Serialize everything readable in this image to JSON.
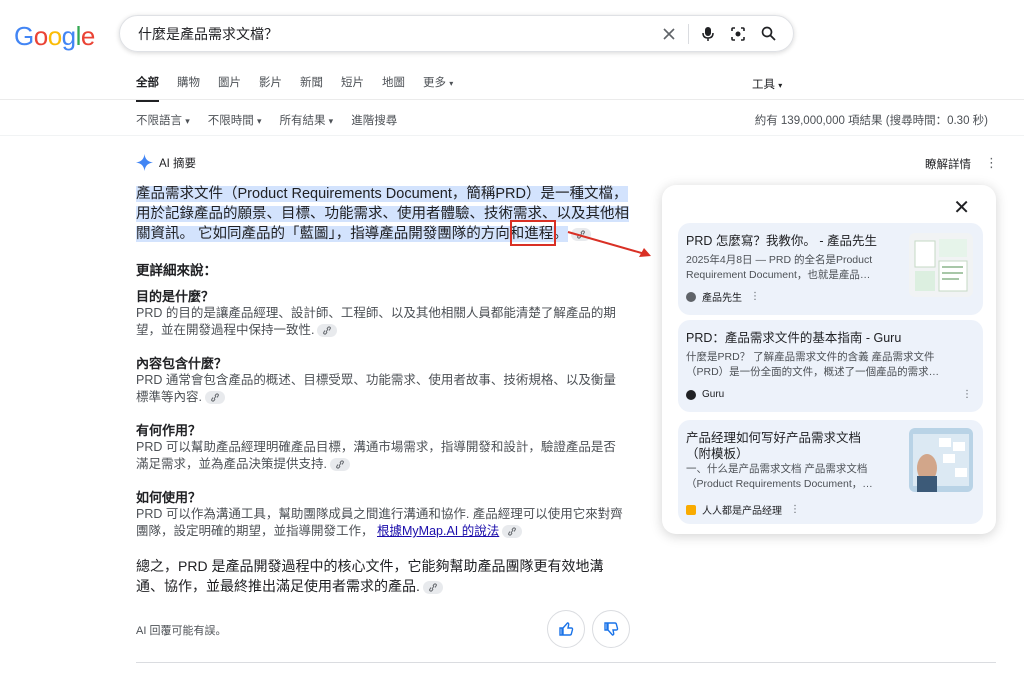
{
  "logo": "Google",
  "search": {
    "query": "什麼是產品需求文檔？"
  },
  "tabs": [
    "全部",
    "購物",
    "圖片",
    "影片",
    "新聞",
    "短片",
    "地圖",
    "更多"
  ],
  "tools_label": "工具",
  "filters": [
    "不限語言",
    "不限時間",
    "所有結果",
    "進階搜尋"
  ],
  "stats": "約有 139,000,000 項結果 (搜尋時間：0.30 秒)",
  "ai": {
    "header": "AI 摘要",
    "learn_more": "瞭解詳情",
    "summary": "產品需求文件（Product Requirements Document，簡稱PRD）是一種文檔，用於記錄產品的願景、目標、功能需求、使用者體驗、技術需求、以及其他相關資訊。 它如同產品的「藍圖」，指導產品開發團隊的方向和進程。",
    "more_heading": "更詳細來說：",
    "sections": [
      {
        "title": "目的是什麼？",
        "body": "PRD 的目的是讓產品經理、設計師、工程師、以及其他相關人員都能清楚了解產品的期望，並在開發過程中保持一致性."
      },
      {
        "title": "內容包含什麼？",
        "body": "PRD 通常會包含產品的概述、目標受眾、功能需求、使用者故事、技術規格、以及衡量標準等內容."
      },
      {
        "title": "有何作用？",
        "body": "PRD 可以幫助產品經理明確產品目標，溝通市場需求，指導開發和設計，驗證產品是否滿足需求，並為產品決策提供支持."
      },
      {
        "title": "如何使用？",
        "body": "PRD 可以作為溝通工具，幫助團隊成員之間進行溝通和協作. 產品經理可以使用它來對齊團隊，設定明確的期望，並指導開發工作，",
        "link": "根據MyMap.AI 的說法"
      }
    ],
    "conclusion": "總之，PRD 是產品開發過程中的核心文件，它能夠幫助產品團隊更有效地溝通、協作，並最終推出滿足使用者需求的產品.",
    "disclaimer": "AI 回覆可能有誤。"
  },
  "sources": [
    {
      "title": "PRD 怎麼寫？我教你。 - 產品先生",
      "snippet": "2025年4月8日 — PRD 的全名是Product Requirement Document，也就是產品…",
      "site": "產品先生"
    },
    {
      "title": "PRD：產品需求文件的基本指南 - Guru",
      "snippet": "什麼是PRD？ 了解產品需求文件的含義 產品需求文件（PRD）是一份全面的文件，概述了一個產品的需求…",
      "site": "Guru"
    },
    {
      "title": "产品经理如何写好产品需求文档（附模板）",
      "snippet": "一、什么是产品需求文档 产品需求文档（Product Requirements Document，…",
      "site": "人人都是产品经理"
    }
  ],
  "colors": {
    "accent": "#1a73e8",
    "highlight": "#d3e3fd",
    "annotation": "#d93025",
    "card_bg": "#edf2fa"
  }
}
